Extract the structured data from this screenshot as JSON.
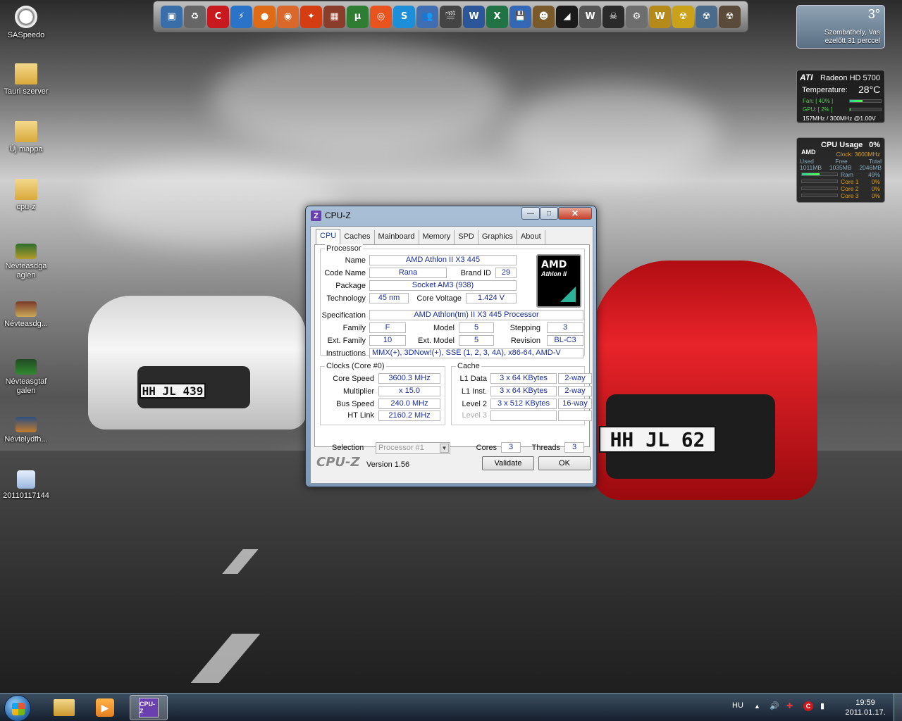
{
  "desktop": {
    "icons": [
      {
        "label": "SASpeedo",
        "glyph": "speedometer-icon"
      },
      {
        "label": "Tauri szerver",
        "glyph": "folder-icon"
      },
      {
        "label": "Új mappa",
        "glyph": "folder-icon"
      },
      {
        "label": "cpu-z",
        "glyph": "folder-icon"
      },
      {
        "label": "Névteasdga aglen",
        "glyph": "image-icon"
      },
      {
        "label": "Névteasdg...",
        "glyph": "image-icon"
      },
      {
        "label": "Névteasgtaf galen",
        "glyph": "image-icon"
      },
      {
        "label": "Névtelydfh...",
        "glyph": "image-icon"
      },
      {
        "label": "20110117144",
        "glyph": "document-icon"
      }
    ],
    "license_plates": {
      "white_car": "HH JL 439",
      "red_car": "HH JL 62"
    }
  },
  "dock": {
    "items": [
      {
        "name": "network-icon",
        "color": "#3a6ea8",
        "glyph": "▣"
      },
      {
        "name": "recycle-bin-icon",
        "color": "#666666",
        "glyph": "♻"
      },
      {
        "name": "comodo-icon",
        "color": "#c8191f",
        "glyph": "C"
      },
      {
        "name": "lightning-icon",
        "color": "#2a73c9",
        "glyph": "⚡"
      },
      {
        "name": "firefox-icon",
        "color": "#e06b16",
        "glyph": "●"
      },
      {
        "name": "ball-icon",
        "color": "#d9682a",
        "glyph": "◉"
      },
      {
        "name": "fire-icon",
        "color": "#d43c12",
        "glyph": "✦"
      },
      {
        "name": "box-icon",
        "color": "#8a3d2a",
        "glyph": "▦"
      },
      {
        "name": "utorrent-icon",
        "color": "#2e7d32",
        "glyph": "µ"
      },
      {
        "name": "origin-icon",
        "color": "#e8531e",
        "glyph": "◎"
      },
      {
        "name": "skype-icon",
        "color": "#1d8ed8",
        "glyph": "S"
      },
      {
        "name": "messenger-icon",
        "color": "#3f6fb2",
        "glyph": "👥"
      },
      {
        "name": "clapper-icon",
        "color": "#444444",
        "glyph": "🎬"
      },
      {
        "name": "word-icon",
        "color": "#2b579a",
        "glyph": "W"
      },
      {
        "name": "excel-icon",
        "color": "#217346",
        "glyph": "X"
      },
      {
        "name": "save-icon",
        "color": "#3467b5",
        "glyph": "💾"
      },
      {
        "name": "game-soldier-icon",
        "color": "#7a5a2a",
        "glyph": "☻"
      },
      {
        "name": "nfs-icon",
        "color": "#1a1a1a",
        "glyph": "◢"
      },
      {
        "name": "wings-icon",
        "color": "#555555",
        "glyph": "W"
      },
      {
        "name": "crysis-icon",
        "color": "#2a2a2a",
        "glyph": "☠"
      },
      {
        "name": "guild-icon",
        "color": "#6e6e6e",
        "glyph": "⚙"
      },
      {
        "name": "wow-icon",
        "color": "#b58a1a",
        "glyph": "W"
      },
      {
        "name": "radiation-icon",
        "color": "#c9a21a",
        "glyph": "☢"
      },
      {
        "name": "radiation-blue-icon",
        "color": "#4a6b8a",
        "glyph": "☢"
      },
      {
        "name": "radiation-dark-icon",
        "color": "#5a4a3a",
        "glyph": "☢"
      }
    ]
  },
  "gadgets": {
    "weather": {
      "temp": "3°",
      "city": "Szombathely, Vas",
      "updated": "ezelőtt 31 perccel"
    },
    "ati": {
      "brand": "ATI",
      "model": "Radeon HD 5700",
      "temp_label": "Temperature:",
      "temp_value": "28°C",
      "fan": "Fan: [ 40% ]",
      "gpu": "GPU: [ 2% ]",
      "clocks": "157MHz / 300MHz @1.00V",
      "fan_fraction": 0.4,
      "gpu_fraction": 0.02
    },
    "cpu": {
      "brand": "AMD",
      "title": "CPU Usage",
      "usage": "0%",
      "clock": "Clock: 3600MHz",
      "mem_headers": [
        "Used",
        "Free",
        "Total"
      ],
      "mem_values": [
        "1011MB",
        "1035MB",
        "2046MB"
      ],
      "ram_label": "Ram",
      "ram_value": "49%",
      "ram_fraction": 0.49,
      "cores": [
        {
          "label": "Core 1",
          "value": "0%"
        },
        {
          "label": "Core 2",
          "value": "0%"
        },
        {
          "label": "Core 3",
          "value": "0%"
        }
      ]
    }
  },
  "cpuz": {
    "title": "CPU-Z",
    "icon_letter": "Z",
    "controls": {
      "minimize": "—",
      "maximize": "□",
      "close": "✕"
    },
    "tabs": [
      "CPU",
      "Caches",
      "Mainboard",
      "Memory",
      "SPD",
      "Graphics",
      "About"
    ],
    "processor": {
      "group": "Processor",
      "name_label": "Name",
      "name": "AMD Athlon II X3 445",
      "codename_label": "Code Name",
      "codename": "Rana",
      "brandid_label": "Brand ID",
      "brandid": "29",
      "package_label": "Package",
      "package": "Socket AM3 (938)",
      "technology_label": "Technology",
      "technology": "45 nm",
      "voltage_label": "Core Voltage",
      "voltage": "1.424 V",
      "spec_label": "Specification",
      "spec": "AMD Athlon(tm) II X3 445 Processor",
      "family_label": "Family",
      "family": "F",
      "model_label": "Model",
      "model": "5",
      "stepping_label": "Stepping",
      "stepping": "3",
      "extfamily_label": "Ext. Family",
      "extfamily": "10",
      "extmodel_label": "Ext. Model",
      "extmodel": "5",
      "revision_label": "Revision",
      "revision": "BL-C3",
      "instructions_label": "Instructions",
      "instructions": "MMX(+), 3DNow!(+), SSE (1, 2, 3, 4A), x86-64, AMD-V",
      "logo_brand": "AMD",
      "logo_sub": "Athlon II"
    },
    "clocks": {
      "group": "Clocks (Core #0)",
      "corespeed_label": "Core Speed",
      "corespeed": "3600.3 MHz",
      "multiplier_label": "Multiplier",
      "multiplier": "x 15.0",
      "busspeed_label": "Bus Speed",
      "busspeed": "240.0 MHz",
      "htlink_label": "HT Link",
      "htlink": "2160.2 MHz"
    },
    "cache": {
      "group": "Cache",
      "rows": [
        {
          "label": "L1 Data",
          "size": "3 x 64 KBytes",
          "assoc": "2-way"
        },
        {
          "label": "L1 Inst.",
          "size": "3 x 64 KBytes",
          "assoc": "2-way"
        },
        {
          "label": "Level 2",
          "size": "3 x 512 KBytes",
          "assoc": "16-way"
        },
        {
          "label": "Level 3",
          "size": "",
          "assoc": ""
        }
      ]
    },
    "selection": {
      "label": "Selection",
      "value": "Processor #1",
      "cores_label": "Cores",
      "cores": "3",
      "threads_label": "Threads",
      "threads": "3"
    },
    "footer": {
      "logo": "CPU-Z",
      "version": "Version 1.56",
      "validate": "Validate",
      "ok": "OK"
    }
  },
  "taskbar": {
    "apps": [
      {
        "name": "explorer-icon"
      },
      {
        "name": "media-player-icon"
      },
      {
        "name": "cpuz-taskbar-icon",
        "label": "CPU-Z"
      }
    ],
    "lang": "HU",
    "time": "19:59",
    "date": "2011.01.17."
  }
}
